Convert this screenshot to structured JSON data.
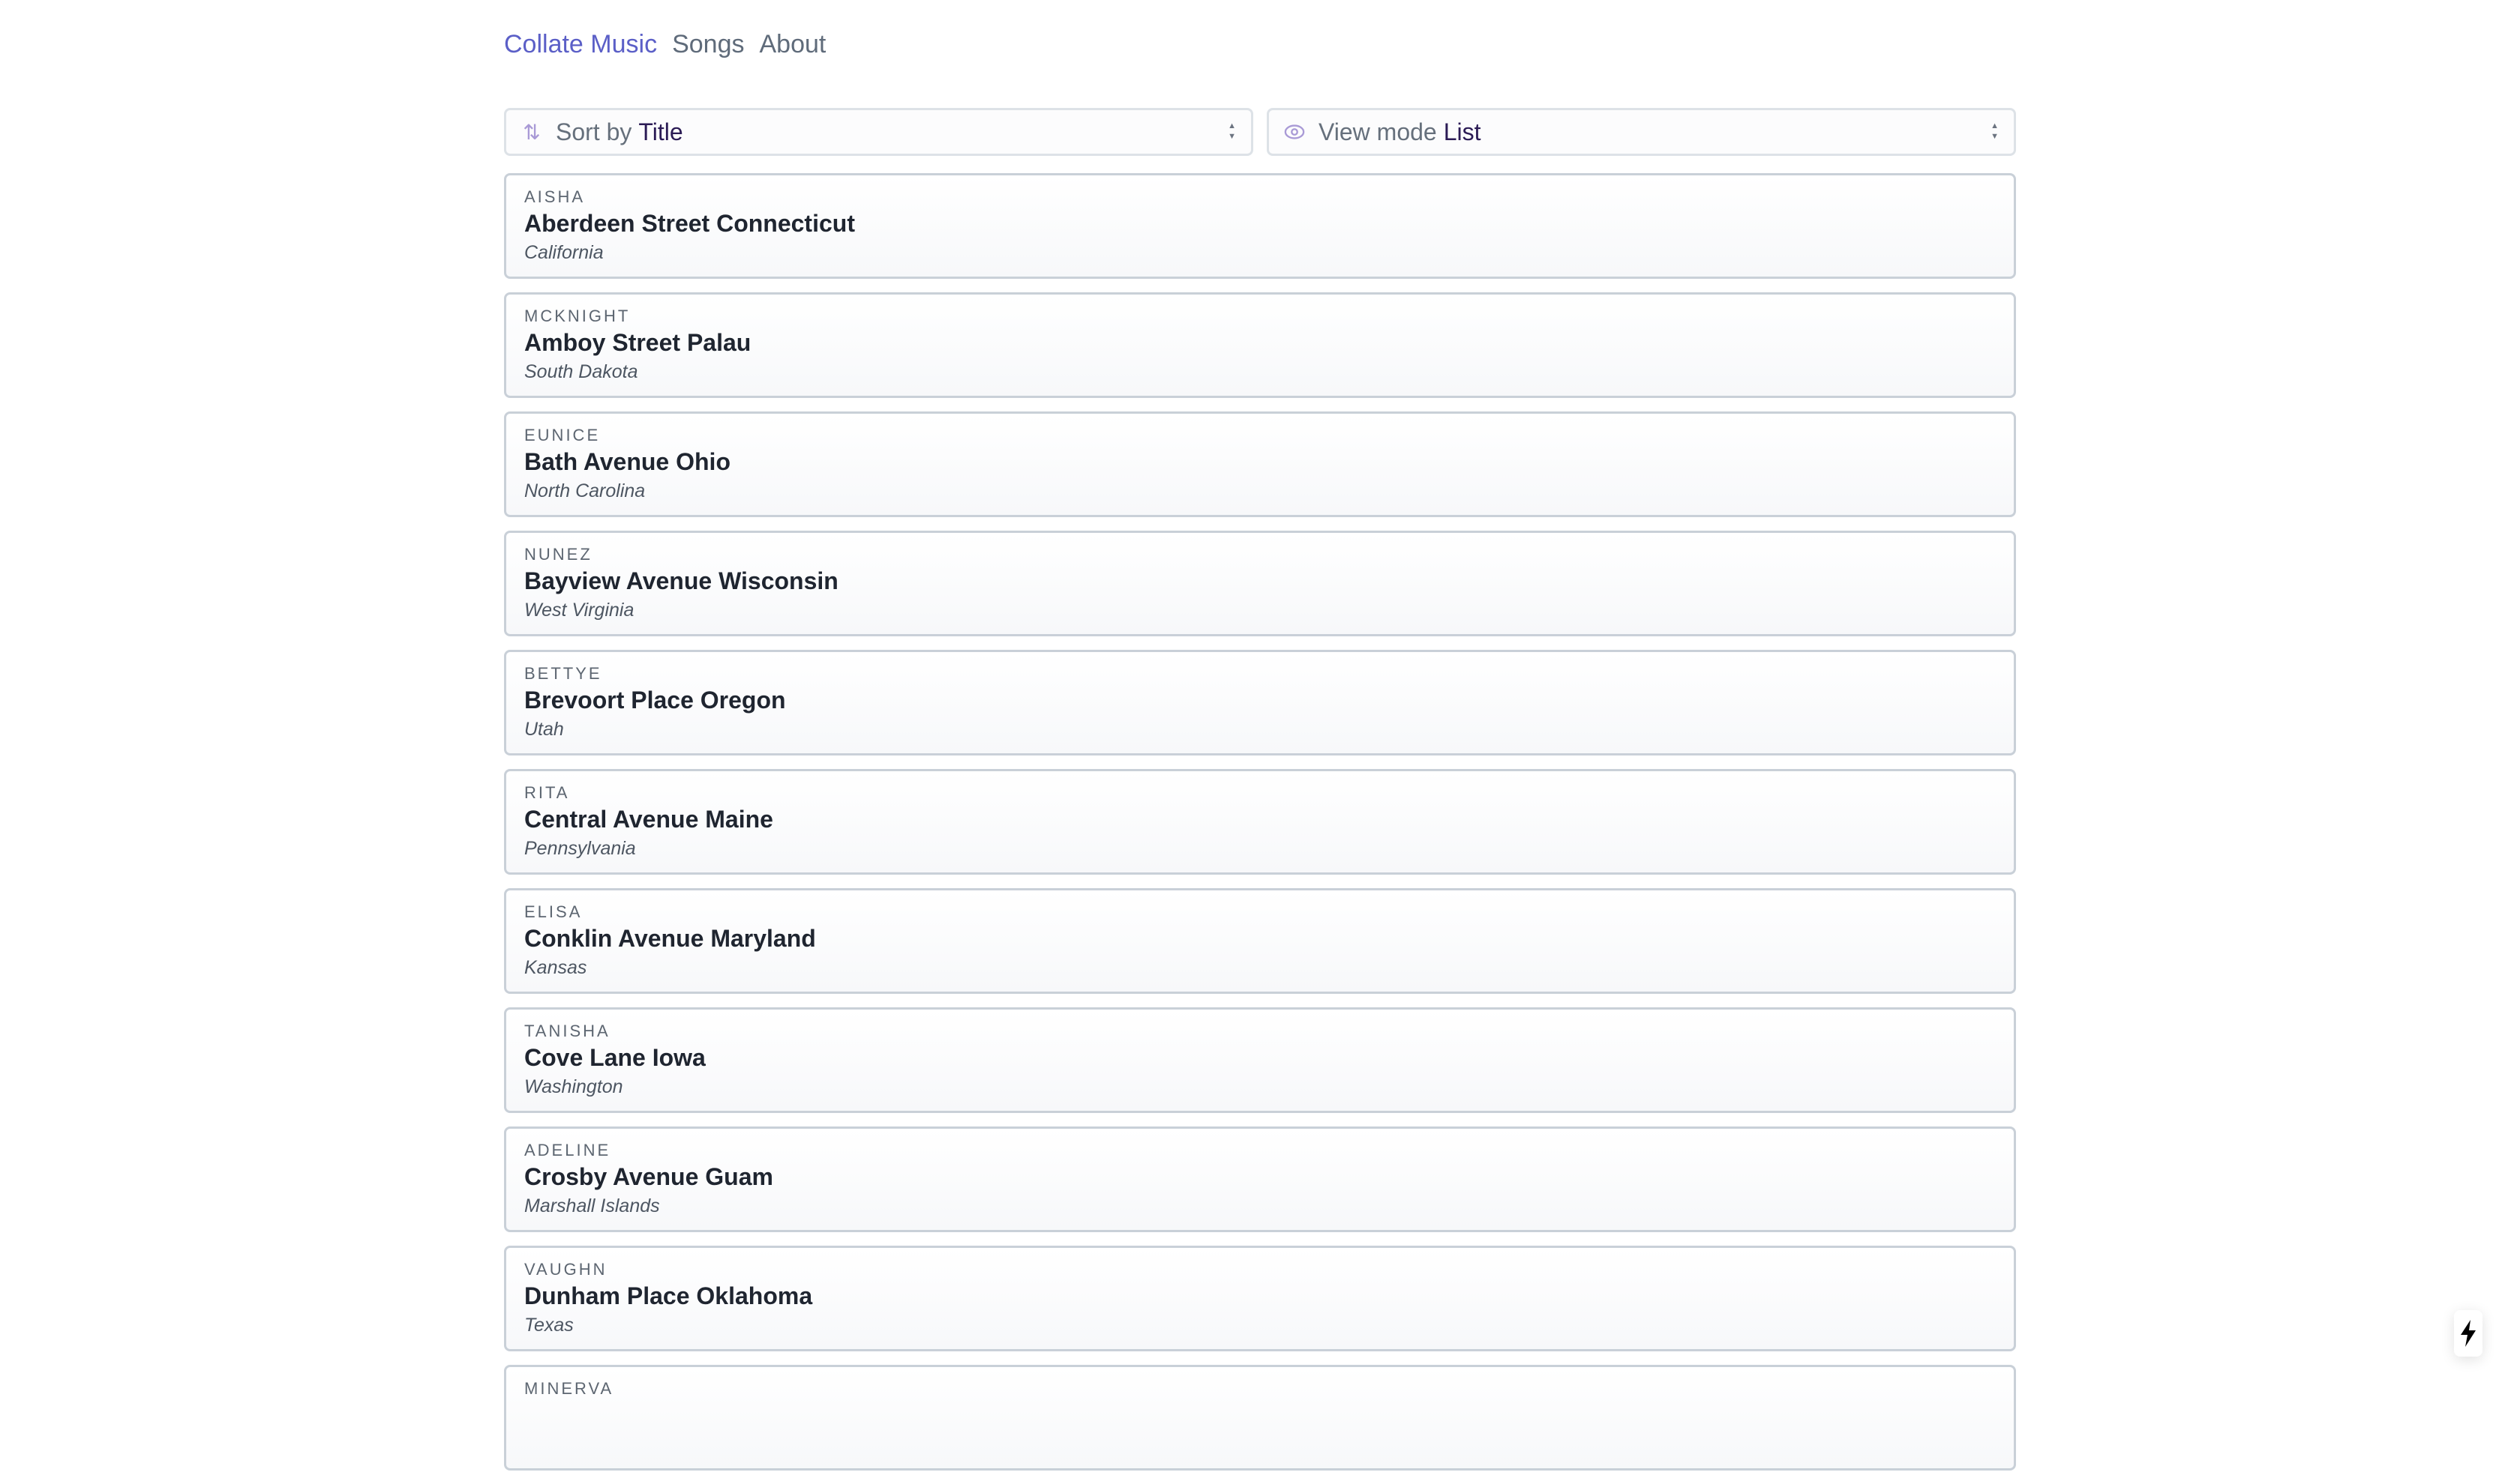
{
  "nav": {
    "brand": "Collate Music",
    "songs": "Songs",
    "about": "About"
  },
  "controls": {
    "sort": {
      "label": "Sort by",
      "value": "Title",
      "icon": "sort-arrows-icon"
    },
    "view": {
      "label": "View mode",
      "value": "List",
      "icon": "eye-icon"
    }
  },
  "songs": [
    {
      "artist": "AISHA",
      "title": "Aberdeen Street Connecticut",
      "location": "California"
    },
    {
      "artist": "MCKNIGHT",
      "title": "Amboy Street Palau",
      "location": "South Dakota"
    },
    {
      "artist": "EUNICE",
      "title": "Bath Avenue Ohio",
      "location": "North Carolina"
    },
    {
      "artist": "NUNEZ",
      "title": "Bayview Avenue Wisconsin",
      "location": "West Virginia"
    },
    {
      "artist": "BETTYE",
      "title": "Brevoort Place Oregon",
      "location": "Utah"
    },
    {
      "artist": "RITA",
      "title": "Central Avenue Maine",
      "location": "Pennsylvania"
    },
    {
      "artist": "ELISA",
      "title": "Conklin Avenue Maryland",
      "location": "Kansas"
    },
    {
      "artist": "TANISHA",
      "title": "Cove Lane Iowa",
      "location": "Washington"
    },
    {
      "artist": "ADELINE",
      "title": "Crosby Avenue Guam",
      "location": "Marshall Islands"
    },
    {
      "artist": "VAUGHN",
      "title": "Dunham Place Oklahoma",
      "location": "Texas"
    },
    {
      "artist": "MINERVA"
    }
  ]
}
